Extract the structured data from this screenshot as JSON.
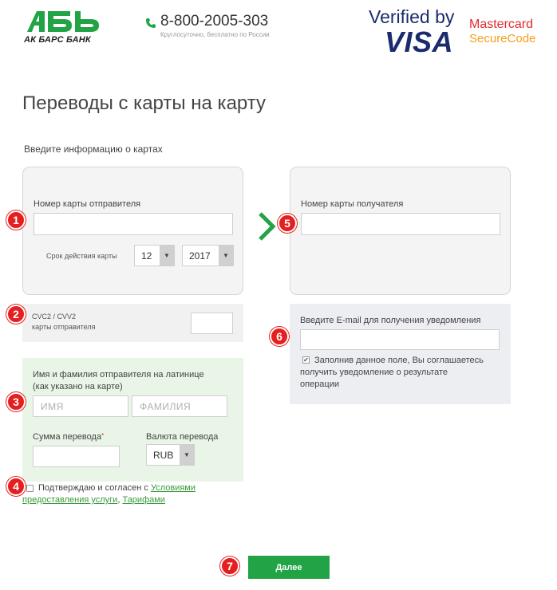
{
  "header": {
    "bank_name": "АК БАРС БАНК",
    "phone": "8-800-2005-303",
    "phone_note": "Круглосуточно, бесплатно по России",
    "visa_top": "Verified by",
    "visa_main": "VISA",
    "mastercard_top": "Mastercard",
    "mastercard_bottom": "SecureCode"
  },
  "page": {
    "title": "Переводы с карты на карту",
    "section_label": "Введите информацию о картах"
  },
  "sender": {
    "card_label": "Номер карты отправителя",
    "card_value": "",
    "expiry_label": "Срок действия карты",
    "month": "12",
    "year": "2017"
  },
  "recipient": {
    "card_label": "Номер карты получателя",
    "card_value": ""
  },
  "cvc": {
    "label_line1": "CVC2 / CVV2",
    "label_line2": "карты отправителя",
    "value": ""
  },
  "email": {
    "label": "Введите E-mail для получения уведомления",
    "value": "",
    "consent_line1": "Заполнив данное поле, Вы соглашаетесь",
    "consent_line2": "получить уведомление о результате",
    "consent_line3": "операции",
    "consent_checked": true
  },
  "name": {
    "label_line1": "Имя и фамилия отправителя на латинице",
    "label_line2": "(как указано на карте)",
    "first_placeholder": "ИМЯ",
    "last_placeholder": "ФАМИЛИЯ",
    "amount_label": "Сумма перевода",
    "amount_required_mark": "*",
    "amount_value": "",
    "currency_label": "Валюта перевода",
    "currency": "RUB"
  },
  "agreement": {
    "text": "Подтверждаю и согласен с ",
    "link_conditions_part1": "Условиями",
    "link_conditions_part2": "предоставления услуги",
    "separator": ", ",
    "link_tariffs": "Тарифами",
    "checked": false
  },
  "actions": {
    "next_label": "Далее"
  },
  "badges": [
    "1",
    "2",
    "3",
    "4",
    "5",
    "6",
    "7"
  ],
  "colors": {
    "brand_green": "#21a346",
    "badge_red": "#e51f1f",
    "visa_blue": "#1a2c6d",
    "mastercard_red": "#e5292f",
    "mastercard_orange": "#f79e1b"
  }
}
